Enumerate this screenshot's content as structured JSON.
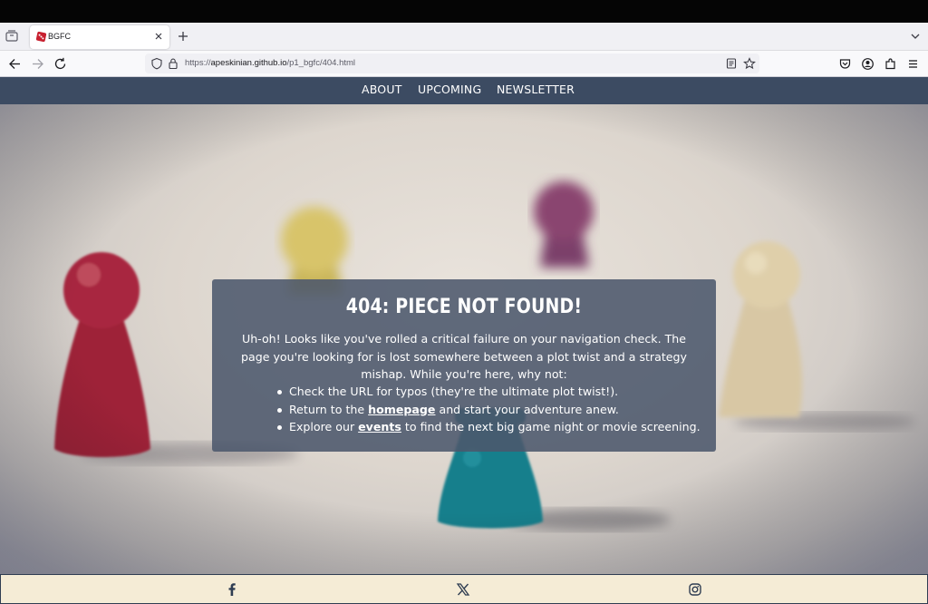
{
  "browser": {
    "tab_title": "BGFC",
    "url_prefix": "https://",
    "url_host": "apeskinian.github.io",
    "url_path": "/p1_bgfc/404.html"
  },
  "site_nav": {
    "items": [
      {
        "label": "ABOUT"
      },
      {
        "label": "UPCOMING"
      },
      {
        "label": "NEWSLETTER"
      }
    ]
  },
  "error_card": {
    "title": "404: PIECE NOT FOUND!",
    "intro": "Uh-oh! Looks like you've rolled a critical failure on your navigation check. The page you're looking for is lost somewhere between a plot twist and a strategy mishap. While you're here, why not:",
    "items": [
      {
        "text": "Check the URL for typos (they're the ultimate plot twist!)."
      },
      {
        "before": "Return to the ",
        "link": "homepage",
        "after": " and start your adventure anew."
      },
      {
        "before": "Explore our ",
        "link": "events",
        "after": " to find the next big game night or movie screening."
      }
    ]
  },
  "footer": {
    "icons": [
      "facebook-icon",
      "x-icon",
      "instagram-icon"
    ]
  },
  "colors": {
    "site_nav_bg": "#3c4b62",
    "card_bg": "#4c586c",
    "footer_bg": "#f5ecd6"
  }
}
